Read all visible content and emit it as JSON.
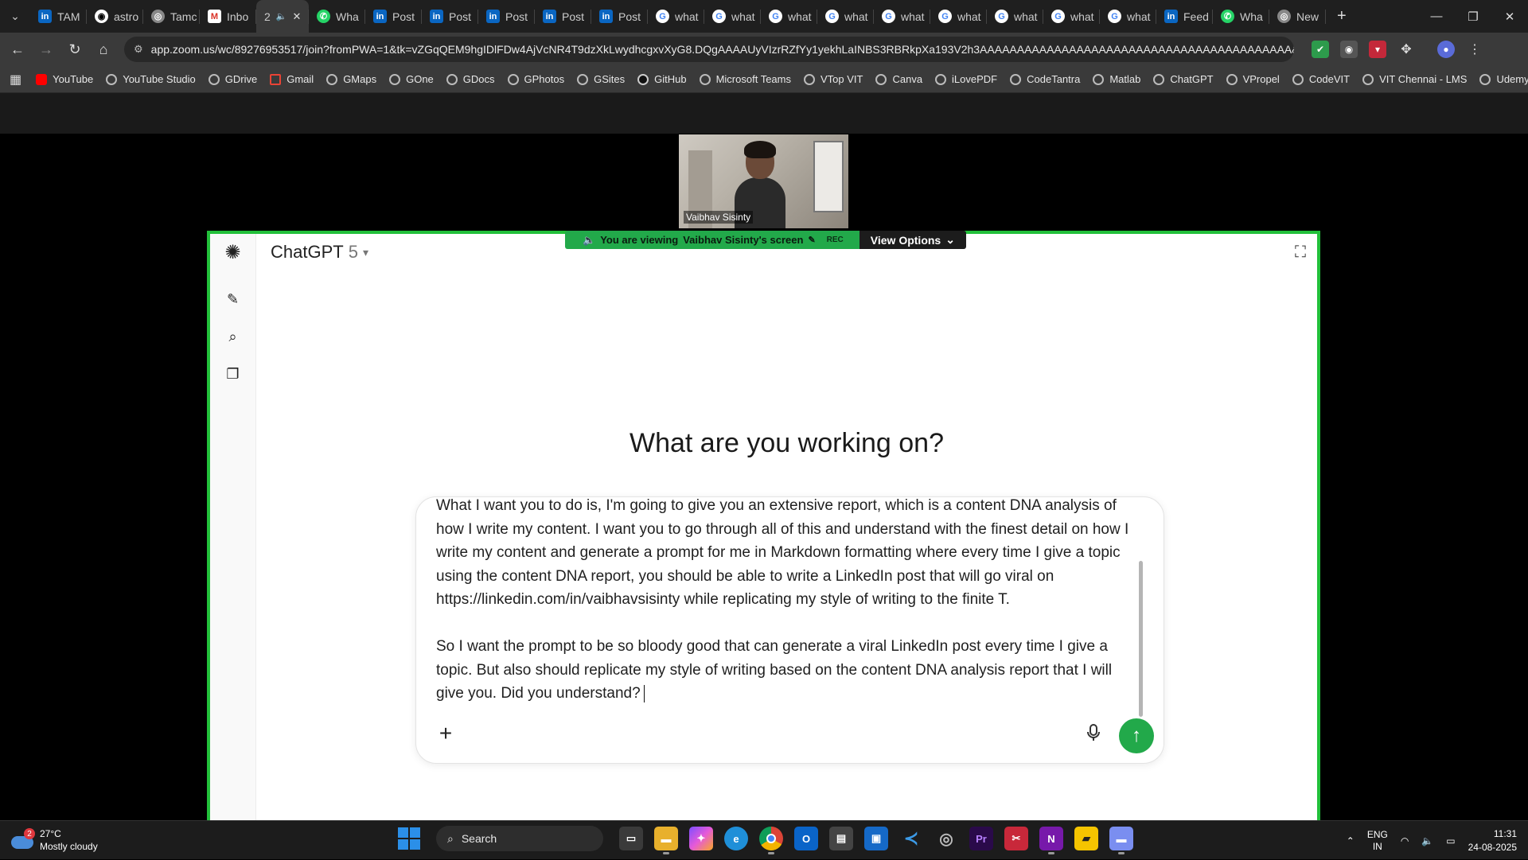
{
  "browser": {
    "tabs": [
      {
        "label": "TAM",
        "icon": "linkedin"
      },
      {
        "label": "astro",
        "icon": "github"
      },
      {
        "label": "Tamc",
        "icon": "chrome"
      },
      {
        "label": "Inbo",
        "icon": "gmail"
      },
      {
        "label": "2",
        "icon": "audio",
        "active": true
      },
      {
        "label": "Wha",
        "icon": "whatsapp"
      },
      {
        "label": "Post",
        "icon": "linkedin"
      },
      {
        "label": "Post",
        "icon": "linkedin"
      },
      {
        "label": "Post",
        "icon": "linkedin"
      },
      {
        "label": "Post",
        "icon": "linkedin"
      },
      {
        "label": "Post",
        "icon": "linkedin"
      },
      {
        "label": "what",
        "icon": "google"
      },
      {
        "label": "what",
        "icon": "google"
      },
      {
        "label": "what",
        "icon": "google"
      },
      {
        "label": "what",
        "icon": "google"
      },
      {
        "label": "what",
        "icon": "google"
      },
      {
        "label": "what",
        "icon": "google"
      },
      {
        "label": "what",
        "icon": "google"
      },
      {
        "label": "what",
        "icon": "google"
      },
      {
        "label": "what",
        "icon": "google"
      },
      {
        "label": "Feed",
        "icon": "linkedin"
      },
      {
        "label": "Wha",
        "icon": "whatsapp"
      },
      {
        "label": "New",
        "icon": "chrome"
      }
    ],
    "url": "app.zoom.us/wc/89276953517/join?fromPWA=1&tk=vZGqQEM9hgIDlFDw4AjVcNR4T9dzXkLwydhcgxvXyG8.DQgAAAAUyVIzrRZfYy1yekhLaINBS3RBRkpXa193V2h3AAAAAAAAAAAAAAAAAAAAAAAAAAAAAAAAAAAAAAAAAA&_x_zm_r...",
    "bookmarks": [
      "YouTube",
      "YouTube Studio",
      "GDrive",
      "Gmail",
      "GMaps",
      "GOne",
      "GDocs",
      "GPhotos",
      "GSites",
      "GitHub",
      "Microsoft Teams",
      "VTop VIT",
      "Canva",
      "iLovePDF",
      "CodeTantra",
      "Matlab",
      "ChatGPT",
      "VPropel",
      "CodeVIT",
      "VIT Chennai - LMS",
      "Udemy"
    ]
  },
  "zoom": {
    "participant_name": "Vaibhav Sisinty",
    "share_banner": "You are viewing",
    "share_owner": "Vaibhav Sisinty's screen",
    "rec_label": "REC",
    "view_options": "View Options"
  },
  "chatgpt": {
    "model_name": "ChatGPT",
    "model_version": "5",
    "headline": "What are you working on?",
    "composer_paragraphs": [
      "What I want you to do is, I'm going to give you an extensive report, which is a content DNA analysis of how I write my content. I want you to go through all of this and understand with the finest detail on how I write my content and generate a prompt for me in Markdown formatting where every time I give a topic using the content DNA report, you should be able to write a LinkedIn post that will go viral on https://linkedin.com/in/vaibhavsisinty while replicating my style of writing to the finite T.",
      "So I want the prompt to be so bloody good that can generate a viral LinkedIn post every time I give a topic. But also should replicate my style of writing based on the content DNA analysis report that I will give you. Did you understand?"
    ]
  },
  "taskbar": {
    "weather_temp": "27°C",
    "weather_desc": "Mostly cloudy",
    "weather_badge": "2",
    "search_label": "Search",
    "lang_top": "ENG",
    "lang_bottom": "IN",
    "time": "11:31",
    "date": "24-08-2025"
  },
  "colors": {
    "share_green": "#22a94a",
    "share_border": "#22c03a",
    "send_button": "#22a94a"
  }
}
